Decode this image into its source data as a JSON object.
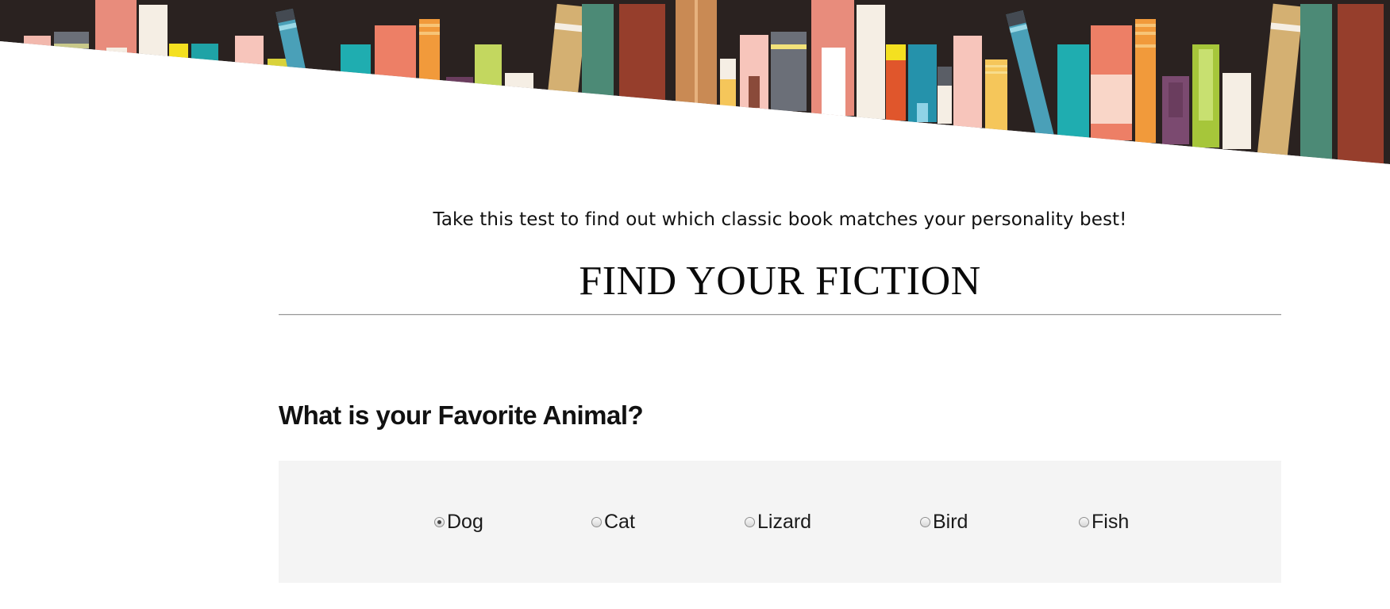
{
  "header": {
    "tagline": "Take this test to find out which classic book matches your personality best!",
    "title": "FIND YOUR FICTION"
  },
  "quiz": {
    "question": "What is your Favorite Animal?",
    "options": [
      {
        "label": "Dog",
        "checked": true
      },
      {
        "label": "Cat",
        "checked": false
      },
      {
        "label": "Lizard",
        "checked": false
      },
      {
        "label": "Bird",
        "checked": false
      },
      {
        "label": "Fish",
        "checked": false
      }
    ]
  },
  "colors": {
    "shelf_background": "#2a2220",
    "page_background": "#ffffff",
    "options_panel_background": "#f4f4f4"
  }
}
